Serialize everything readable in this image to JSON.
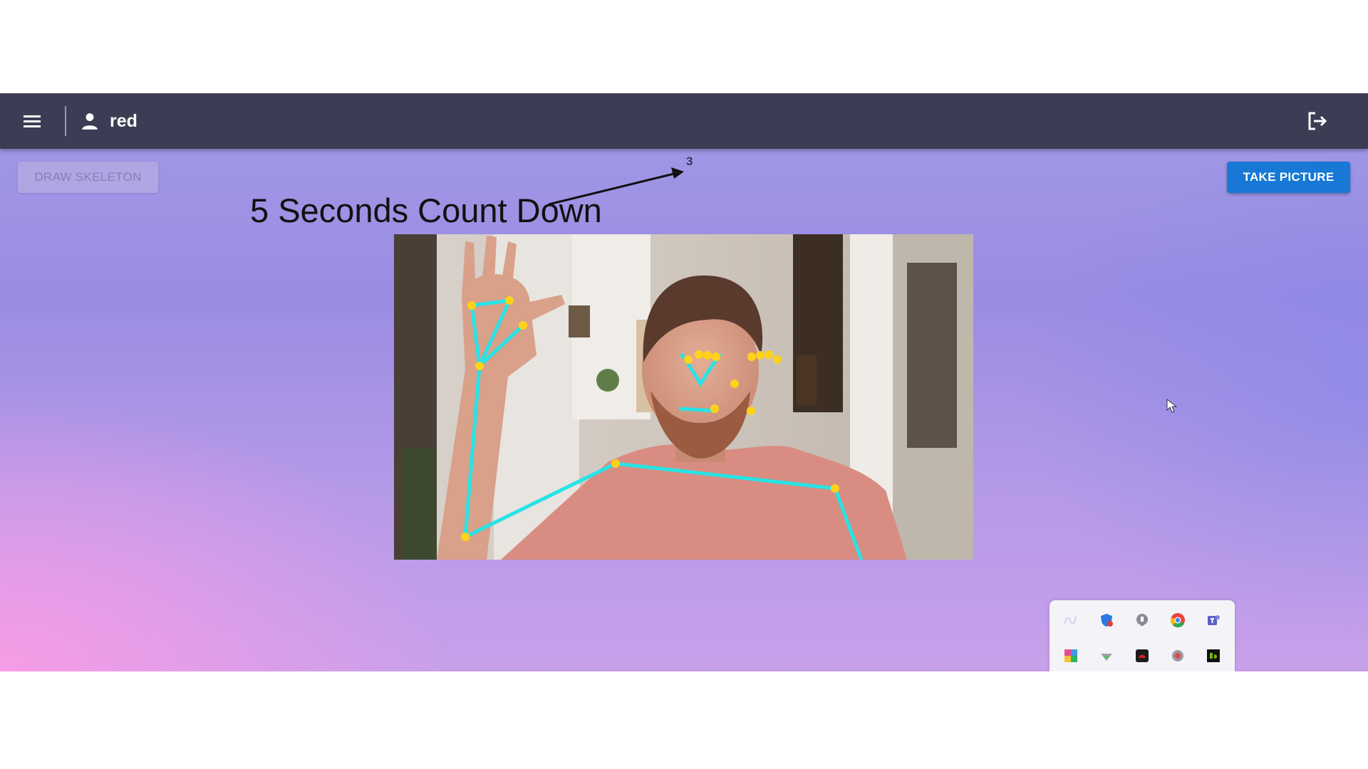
{
  "topbar": {
    "menu_icon": "menu-icon",
    "user_icon": "person-icon",
    "username": "red",
    "logout_icon": "logout-icon"
  },
  "actions": {
    "draw_skeleton_label": "DRAW SKELETON",
    "take_picture_label": "TAKE PICTURE"
  },
  "countdown": {
    "value": "3"
  },
  "annotation": {
    "text": "5 Seconds Count Down"
  },
  "pose_overlay": {
    "line_color": "#27e3e6",
    "keypoint_color": "#ffd21a"
  },
  "tray": {
    "icons": [
      "app-icon",
      "shield-icon",
      "security-icon",
      "chrome-icon",
      "teams-icon",
      "color-picker-icon",
      "network-icon",
      "recorder-icon",
      "settings-icon",
      "nvidia-icon"
    ]
  },
  "colors": {
    "topbar": "#3c3c54",
    "primary_button": "#1778d5"
  }
}
